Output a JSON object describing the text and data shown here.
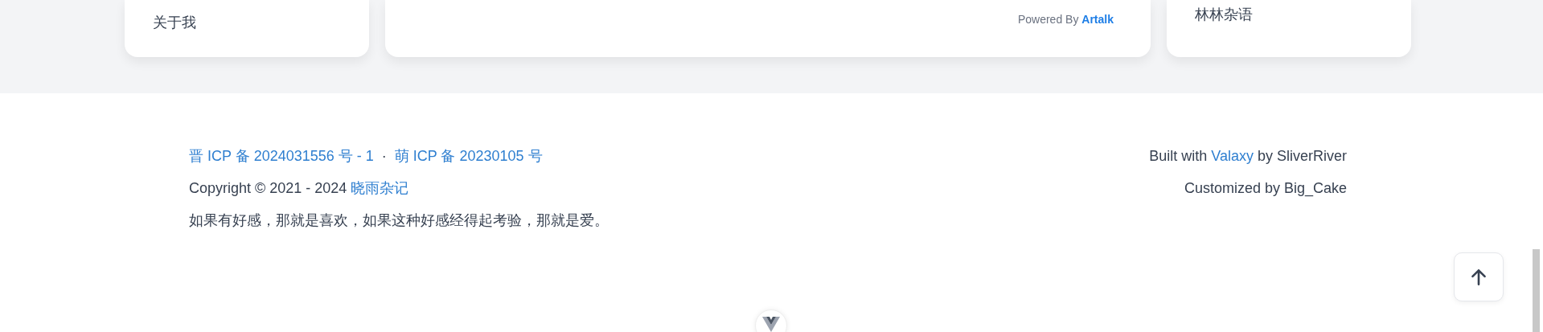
{
  "cards": [
    {
      "kind": "menu",
      "text": "关于我"
    },
    {
      "kind": "comments",
      "powered_label": "Powered By",
      "powered_link": "Artalk"
    },
    {
      "kind": "links",
      "text": "林林杂语"
    }
  ],
  "footer": {
    "icp": [
      "晋 ICP 备 2024031556 号 - 1",
      "萌 ICP 备 20230105 号"
    ],
    "separator": "·",
    "copyright": {
      "text": "Copyright © 2021 - 2024",
      "link": "晓雨杂记"
    },
    "motto": "如果有好感，那就是喜欢，如果这种好感经得起考验，那就是爱。",
    "built": {
      "prefix": "Built with",
      "link": "Valaxy",
      "suffix": "by SliverRiver"
    },
    "customized": "Customized by Big_Cake"
  }
}
